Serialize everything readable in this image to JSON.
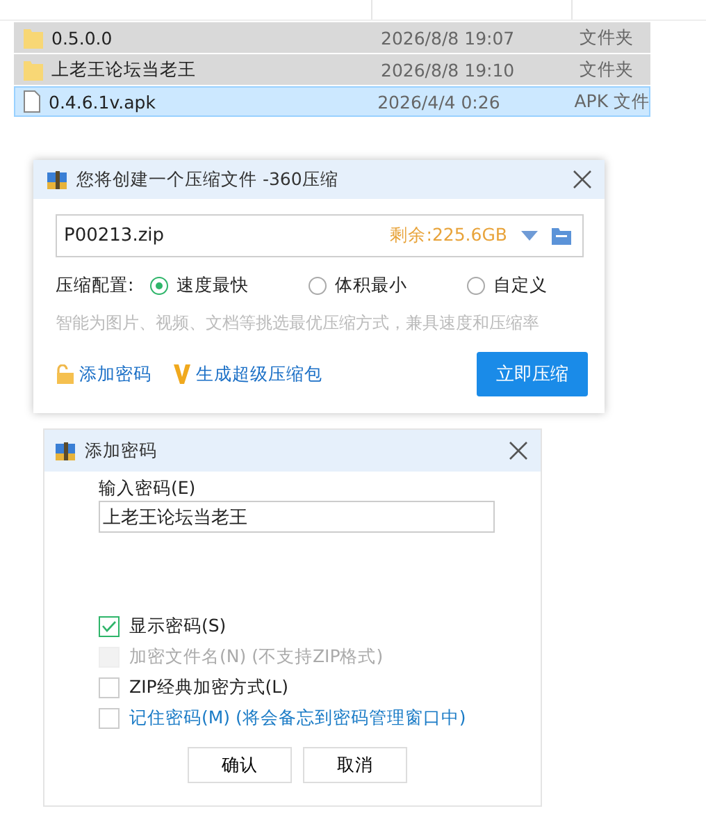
{
  "files": [
    {
      "kind": "folder",
      "name": "0.5.0.0",
      "modified": "2026/8/8 19:07",
      "type": "文件夹",
      "selected": true,
      "focused": false
    },
    {
      "kind": "folder",
      "name": "上老王论坛当老王",
      "modified": "2026/8/8 19:10",
      "type": "文件夹",
      "selected": true,
      "focused": false
    },
    {
      "kind": "file",
      "name": "0.4.6.1v.apk",
      "modified": "2026/4/4 0:26",
      "type": "APK 文件",
      "selected": true,
      "focused": true
    }
  ],
  "compress_dialog": {
    "title": "您将创建一个压缩文件 -360压缩",
    "filename": "P00213.zip",
    "free_space": "剩余:225.6GB",
    "config_label": "压缩配置:",
    "options": [
      {
        "label": "速度最快",
        "selected": true
      },
      {
        "label": "体积最小",
        "selected": false
      },
      {
        "label": "自定义",
        "selected": false
      }
    ],
    "hint": "智能为图片、视频、文档等挑选最优压缩方式，兼具速度和压缩率",
    "add_password": "添加密码",
    "super_package": "生成超级压缩包",
    "compress_button": "立即压缩"
  },
  "password_dialog": {
    "title": "添加密码",
    "field_label": "输入密码(E)",
    "password": "上老王论坛当老王",
    "checkboxes": [
      {
        "kind": "plain",
        "label": "显示密码(S)",
        "checked": true,
        "disabled": false
      },
      {
        "kind": "plain",
        "label": "加密文件名(N) (不支持ZIP格式)",
        "checked": false,
        "disabled": true
      },
      {
        "kind": "plain",
        "label": "ZIP经典加密方式(L)",
        "checked": false,
        "disabled": false
      },
      {
        "kind": "link",
        "label": "记住密码(M) (将会备忘到密码管理窗口中)",
        "checked": false,
        "disabled": false
      }
    ],
    "buttons": [
      "确认",
      "取消"
    ]
  }
}
